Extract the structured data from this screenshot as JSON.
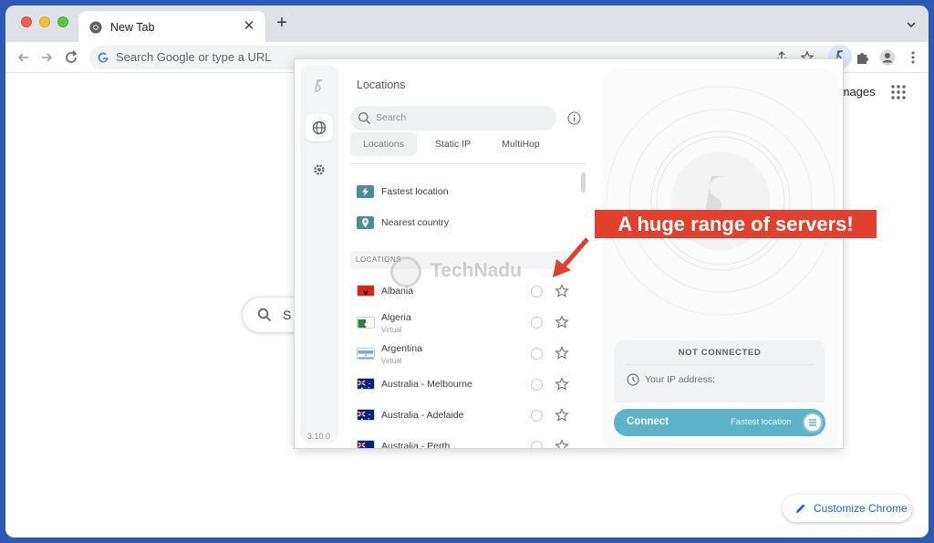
{
  "browser": {
    "tab_title": "New Tab",
    "omnibox_placeholder": "Search Google or type a URL"
  },
  "page": {
    "images_link": "Images",
    "google_search_partial": "S",
    "customize_label": "Customize Chrome"
  },
  "extension": {
    "version": "3.10.0",
    "title": "Locations",
    "search_placeholder": "Search",
    "tabs": [
      {
        "label": "Locations",
        "active": true
      },
      {
        "label": "Static IP",
        "active": false
      },
      {
        "label": "MultiHop",
        "active": false
      }
    ],
    "quick_options": [
      {
        "label": "Fastest location",
        "icon": "lightning-icon"
      },
      {
        "label": "Nearest country",
        "icon": "pin-icon"
      }
    ],
    "section_header": "LOCATIONS",
    "locations": [
      {
        "name": "Albania",
        "sub": "",
        "flag": "albania"
      },
      {
        "name": "Algeria",
        "sub": "Virtual",
        "flag": "algeria"
      },
      {
        "name": "Argentina",
        "sub": "Virtual",
        "flag": "argentina"
      },
      {
        "name": "Australia - Melbourne",
        "sub": "",
        "flag": "australia"
      },
      {
        "name": "Australia - Adelaide",
        "sub": "",
        "flag": "australia"
      },
      {
        "name": "Australia - Perth",
        "sub": "",
        "flag": "australia"
      }
    ],
    "status": {
      "title": "NOT CONNECTED",
      "ip_label": "Your IP address:"
    },
    "connect": {
      "label": "Connect",
      "location": "Fastest location"
    }
  },
  "annotation": {
    "banner": "A huge range of servers!",
    "watermark": "TechNadu"
  },
  "colors": {
    "accent": "#5eb3c8",
    "banner": "#e0402c",
    "quick_icon": "#4d8c95"
  }
}
